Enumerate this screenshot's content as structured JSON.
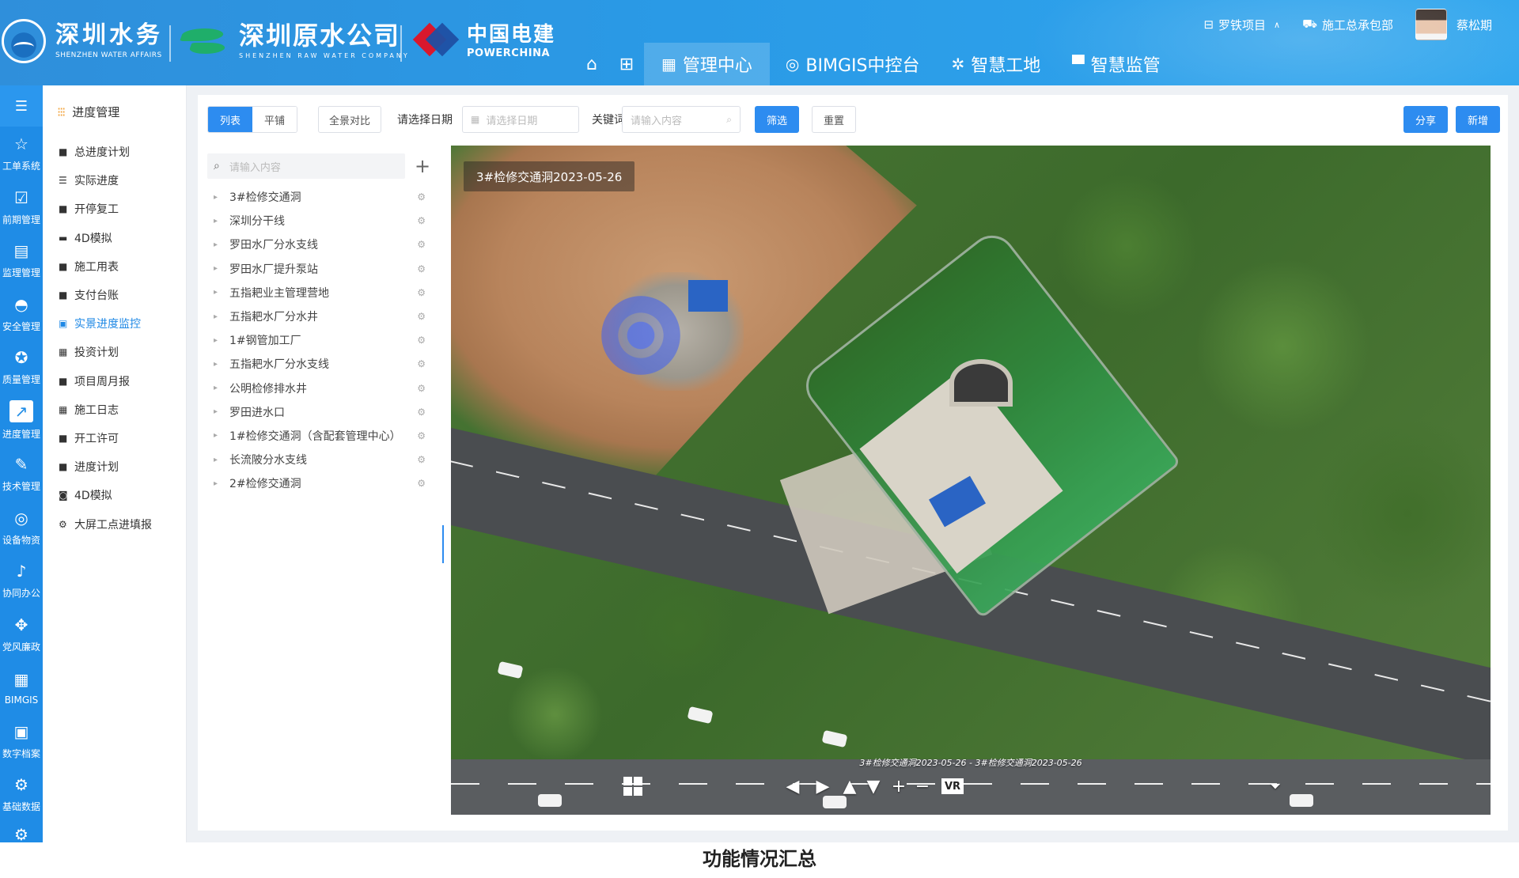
{
  "brand": {
    "shenzhen_water": {
      "cn": "深圳水务",
      "en": "SHENZHEN WATER AFFAIRS"
    },
    "raw_water": {
      "cn": "深圳原水公司",
      "en": "SHENZHEN RAW WATER COMPANY"
    },
    "powerchina": {
      "cn": "中国电建",
      "en": "POWERCHINA"
    }
  },
  "top_nav": {
    "items": [
      {
        "label": "管理中心",
        "icon": "grid-icon",
        "active": true
      },
      {
        "label": "BIMGIS中控台",
        "icon": "dashboard-icon",
        "active": false
      },
      {
        "label": "智慧工地",
        "icon": "chip-icon",
        "active": false
      },
      {
        "label": "智慧监管",
        "icon": "monitor-icon",
        "active": false
      }
    ]
  },
  "user_bar": {
    "project": "罗铁项目",
    "contractor": "施工总承包部",
    "user_name": "蔡松期"
  },
  "rail": {
    "items": [
      {
        "label": "工单系统",
        "icon": "star-icon"
      },
      {
        "label": "前期管理",
        "icon": "check-doc-icon"
      },
      {
        "label": "监理管理",
        "icon": "clipboard-icon"
      },
      {
        "label": "安全管理",
        "icon": "helmet-icon"
      },
      {
        "label": "质量管理",
        "icon": "quality-icon"
      },
      {
        "label": "进度管理",
        "icon": "chart-icon",
        "active": true
      },
      {
        "label": "技术管理",
        "icon": "pen-icon"
      },
      {
        "label": "设备物资",
        "icon": "equipment-icon"
      },
      {
        "label": "协同办公",
        "icon": "bell-icon"
      },
      {
        "label": "党风廉政",
        "icon": "move-icon"
      },
      {
        "label": "BIMGIS",
        "icon": "bimgis-grid-icon"
      },
      {
        "label": "数字档案",
        "icon": "archive-icon"
      },
      {
        "label": "基础数据",
        "icon": "settings-icon"
      }
    ]
  },
  "submenu": {
    "title": "进度管理",
    "items": [
      {
        "label": "总进度计划",
        "icon": "lock-icon"
      },
      {
        "label": "实际进度",
        "icon": "sliders-icon"
      },
      {
        "label": "开停复工",
        "icon": "doc-icon"
      },
      {
        "label": "4D模拟",
        "icon": "screen-icon"
      },
      {
        "label": "施工用表",
        "icon": "folder-icon"
      },
      {
        "label": "支付台账",
        "icon": "doc-icon"
      },
      {
        "label": "实景进度监控",
        "icon": "image-icon",
        "active": true
      },
      {
        "label": "投资计划",
        "icon": "calendar-icon"
      },
      {
        "label": "项目周月报",
        "icon": "doc-icon"
      },
      {
        "label": "施工日志",
        "icon": "calendar-icon"
      },
      {
        "label": "开工许可",
        "icon": "doc-icon"
      },
      {
        "label": "进度计划",
        "icon": "doc-icon"
      },
      {
        "label": "4D模拟",
        "icon": "g-icon"
      },
      {
        "label": "大屏工点进填报",
        "icon": "gear-icon"
      }
    ]
  },
  "toolbar": {
    "view_list": "列表",
    "view_tile": "平铺",
    "compare": "全景对比",
    "date_label": "请选择日期",
    "date_placeholder": "请选择日期",
    "keyword_label": "关键词",
    "keyword_placeholder": "请输入内容",
    "filter": "筛选",
    "reset": "重置",
    "share": "分享",
    "add": "新增"
  },
  "tree": {
    "search_placeholder": "请输入内容",
    "items": [
      "3#检修交通洞",
      "深圳分干线",
      "罗田水厂分水支线",
      "罗田水厂提升泵站",
      "五指耙业主管理营地",
      "五指耙水厂分水井",
      "1#钢管加工厂",
      "五指耙水厂分水支线",
      "公明检修排水井",
      "罗田进水口",
      "1#检修交通洞（含配套管理中心）",
      "长流陂分水支线",
      "2#检修交通洞"
    ]
  },
  "viewer": {
    "scene_title": "3#检修交通洞2023-05-26",
    "caption": "3#检修交通洞2023-05-26 - 3#检修交通洞2023-05-26",
    "vr_label": "VR"
  },
  "page_caption": "功能情况汇总"
}
